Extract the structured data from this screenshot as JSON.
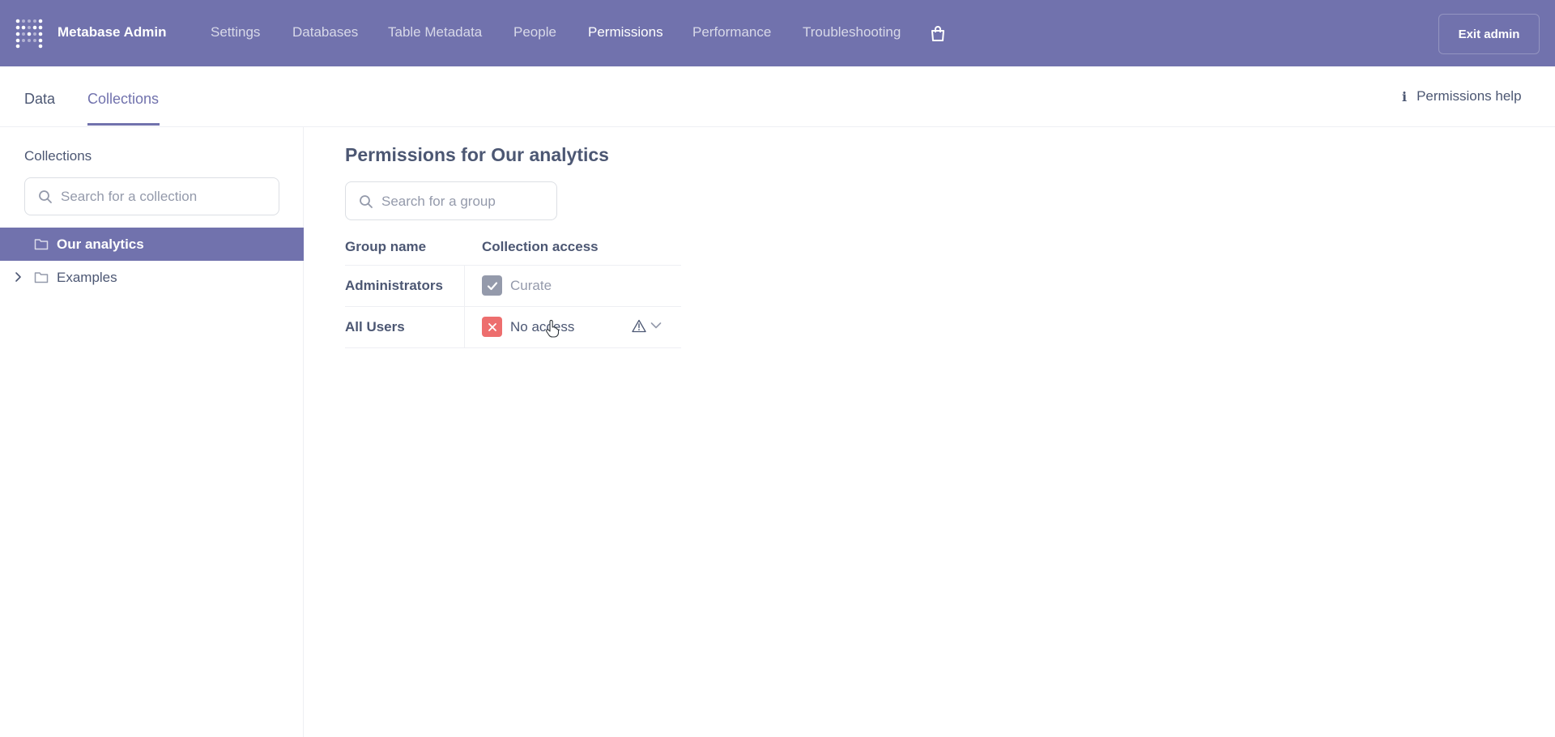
{
  "topnav": {
    "brand": "Metabase Admin",
    "items": [
      {
        "label": "Settings",
        "active": false
      },
      {
        "label": "Databases",
        "active": false
      },
      {
        "label": "Table Metadata",
        "active": false
      },
      {
        "label": "People",
        "active": false
      },
      {
        "label": "Permissions",
        "active": true
      },
      {
        "label": "Performance",
        "active": false
      },
      {
        "label": "Troubleshooting",
        "active": false
      }
    ],
    "store_icon": "shopping-bag-icon",
    "exit_label": "Exit admin"
  },
  "subtabs": {
    "items": [
      {
        "label": "Data",
        "active": false
      },
      {
        "label": "Collections",
        "active": true
      }
    ],
    "help_label": "Permissions help",
    "help_icon": "info-icon"
  },
  "sidebar": {
    "heading": "Collections",
    "search_placeholder": "Search for a collection",
    "tree": [
      {
        "label": "Our analytics",
        "selected": true,
        "expandable": false,
        "icon": "folder-icon"
      },
      {
        "label": "Examples",
        "selected": false,
        "expandable": true,
        "icon": "folder-icon"
      }
    ]
  },
  "main": {
    "title": "Permissions for Our analytics",
    "search_placeholder": "Search for a group",
    "columns": [
      "Group name",
      "Collection access"
    ],
    "rows": [
      {
        "group": "Administrators",
        "access": "Curate",
        "icon": "checkmark-icon",
        "color": "#949aab",
        "editable": false
      },
      {
        "group": "All Users",
        "access": "No access",
        "icon": "close-icon",
        "color": "#ed6e6e",
        "editable": true,
        "warning_icon": "warning-icon"
      }
    ]
  },
  "colors": {
    "brand": "#7172ad",
    "text": "#4c5773",
    "muted": "#949aab",
    "danger": "#ed6e6e"
  }
}
